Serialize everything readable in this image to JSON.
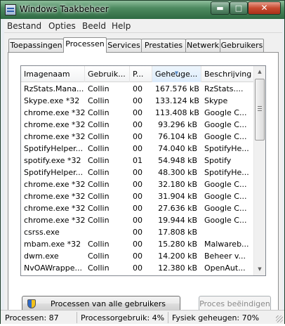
{
  "window": {
    "title": "Windows Taakbeheer",
    "min_label": "▬",
    "max_label": "□",
    "close_label": "✕"
  },
  "menu": [
    "Bestand",
    "Opties",
    "Beeld",
    "Help"
  ],
  "tabs": [
    "Toepassingen",
    "Processen",
    "Services",
    "Prestaties",
    "Netwerk",
    "Gebruikers"
  ],
  "active_tab": "Processen",
  "columns": [
    "Imagenaam",
    "Gebruik...",
    "P...",
    "Geheuge...",
    "Beschrijving"
  ],
  "sorted_column": "Geheuge...",
  "rows": [
    {
      "name": "RzStats.Mana...",
      "user": "Collin",
      "cpu": "00",
      "mem": "167.576 kB",
      "desc": "RzStats...."
    },
    {
      "name": "Skype.exe *32",
      "user": "Collin",
      "cpu": "00",
      "mem": "133.124 kB",
      "desc": "Skype"
    },
    {
      "name": "chrome.exe *32",
      "user": "Collin",
      "cpu": "00",
      "mem": "113.408 kB",
      "desc": "Google C..."
    },
    {
      "name": "chrome.exe *32",
      "user": "Collin",
      "cpu": "00",
      "mem": "93.296 kB",
      "desc": "Google C..."
    },
    {
      "name": "chrome.exe *32",
      "user": "Collin",
      "cpu": "00",
      "mem": "76.104 kB",
      "desc": "Google C..."
    },
    {
      "name": "SpotifyHelper...",
      "user": "Collin",
      "cpu": "00",
      "mem": "74.040 kB",
      "desc": "SpotifyHe..."
    },
    {
      "name": "spotify.exe *32",
      "user": "Collin",
      "cpu": "01",
      "mem": "54.948 kB",
      "desc": "Spotify"
    },
    {
      "name": "SpotifyHelper...",
      "user": "Collin",
      "cpu": "00",
      "mem": "48.300 kB",
      "desc": "SpotifyHe..."
    },
    {
      "name": "chrome.exe *32",
      "user": "Collin",
      "cpu": "00",
      "mem": "32.180 kB",
      "desc": "Google C..."
    },
    {
      "name": "chrome.exe *32",
      "user": "Collin",
      "cpu": "00",
      "mem": "31.904 kB",
      "desc": "Google C..."
    },
    {
      "name": "chrome.exe *32",
      "user": "Collin",
      "cpu": "00",
      "mem": "27.636 kB",
      "desc": "Google C..."
    },
    {
      "name": "chrome.exe *32",
      "user": "Collin",
      "cpu": "00",
      "mem": "19.944 kB",
      "desc": "Google C..."
    },
    {
      "name": "csrss.exe",
      "user": "",
      "cpu": "00",
      "mem": "17.808 kB",
      "desc": ""
    },
    {
      "name": "mbam.exe *32",
      "user": "Collin",
      "cpu": "00",
      "mem": "15.280 kB",
      "desc": "Malwareb..."
    },
    {
      "name": "dwm.exe",
      "user": "Collin",
      "cpu": "00",
      "mem": "14.200 kB",
      "desc": "Beheer v..."
    },
    {
      "name": "NvOAWrappe...",
      "user": "Collin",
      "cpu": "00",
      "mem": "12.380 kB",
      "desc": "OpenAut..."
    }
  ],
  "buttons": {
    "show_all": "Processen van alle gebruikers weergeven",
    "end_process": "Proces beëindigen"
  },
  "status": {
    "processes": "Processen: 87",
    "cpu": "Processorgebruik: 4%",
    "memory": "Fysiek geheugen: 70%"
  }
}
